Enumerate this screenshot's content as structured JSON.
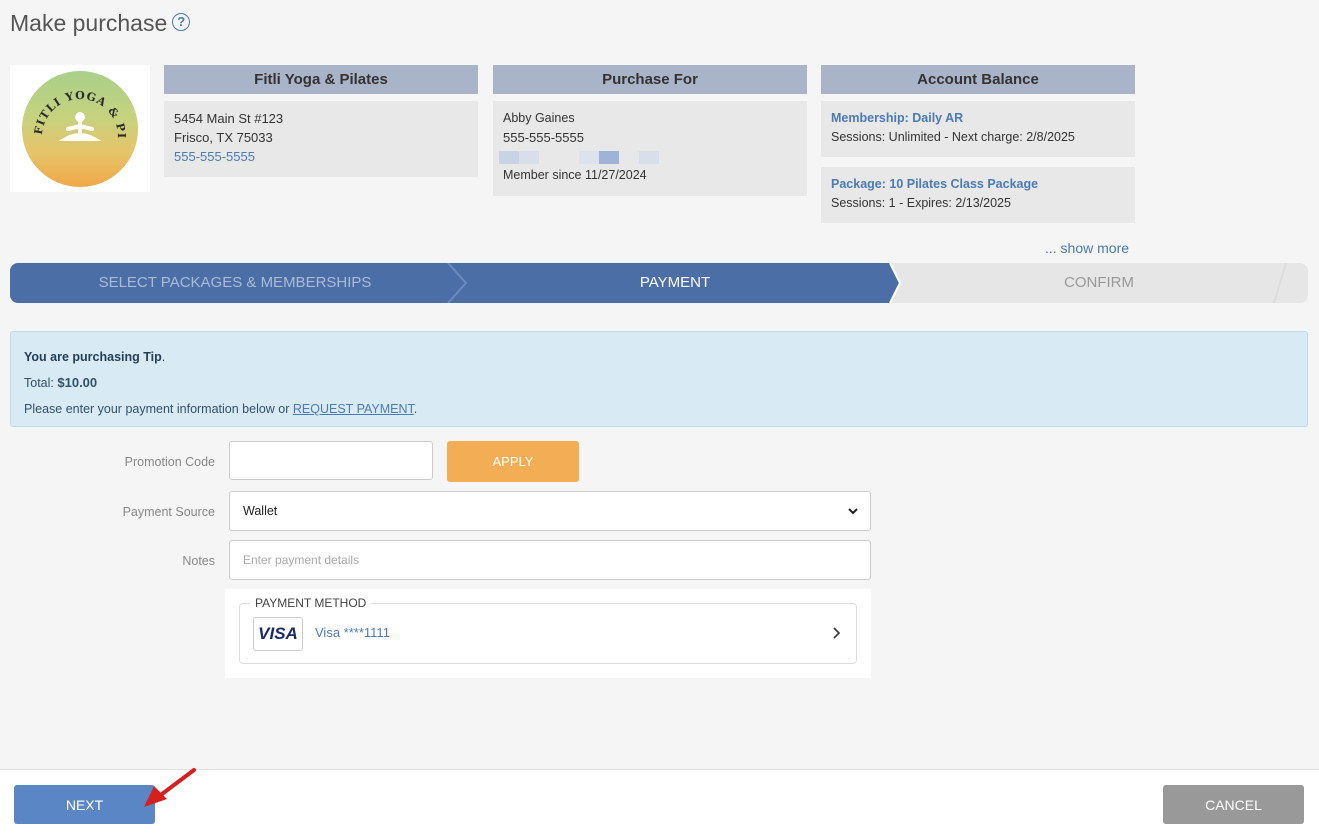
{
  "page": {
    "title": "Make purchase"
  },
  "studio": {
    "header": "Fitli Yoga & Pilates",
    "address1": "5454 Main St #123",
    "address2": "Frisco, TX 75033",
    "phone": "555-555-5555"
  },
  "purchase_for": {
    "header": "Purchase For",
    "name": "Abby Gaines",
    "phone": "555-555-5555",
    "member_since": "Member since 11/27/2024"
  },
  "account_balance": {
    "header": "Account Balance",
    "items": [
      {
        "title": "Membership: Daily AR",
        "detail": "Sessions: Unlimited -  Next charge: 2/8/2025"
      },
      {
        "title": "Package: 10 Pilates Class Package",
        "detail": "Sessions: 1 -  Expires: 2/13/2025"
      }
    ],
    "show_more": "... show more"
  },
  "steps": [
    {
      "label": "SELECT PACKAGES & MEMBERSHIPS",
      "state": "done"
    },
    {
      "label": "PAYMENT",
      "state": "active"
    },
    {
      "label": "CONFIRM",
      "state": "pending"
    }
  ],
  "alert": {
    "purchasing_prefix": "You are purchasing Tip",
    "total_label": "Total:",
    "total_value": "$10.00",
    "instructions_prefix": "Please enter your payment information below or ",
    "request_link": "REQUEST PAYMENT",
    "instructions_suffix": "."
  },
  "form": {
    "promo_label": "Promotion Code",
    "promo_value": "",
    "apply_label": "APPLY",
    "source_label": "Payment Source",
    "source_value": "Wallet",
    "notes_label": "Notes",
    "notes_placeholder": "Enter payment details"
  },
  "payment_method": {
    "legend": "PAYMENT METHOD",
    "brand": "VISA",
    "card_label": "Visa ****1111"
  },
  "footer": {
    "next_label": "NEXT",
    "cancel_label": "CANCEL"
  },
  "colors": {
    "primary": "#4b6ea6",
    "next_button": "#5b86c6",
    "apply_button": "#f2ad55",
    "cancel_button": "#999999",
    "link": "#4a7ab8",
    "alert_bg": "#d8ebf4"
  },
  "icons": {
    "help": "question-circle-icon",
    "select": "chevron-down-icon",
    "method_arrow": "chevron-right-icon",
    "annotation": "red-arrow-icon"
  }
}
